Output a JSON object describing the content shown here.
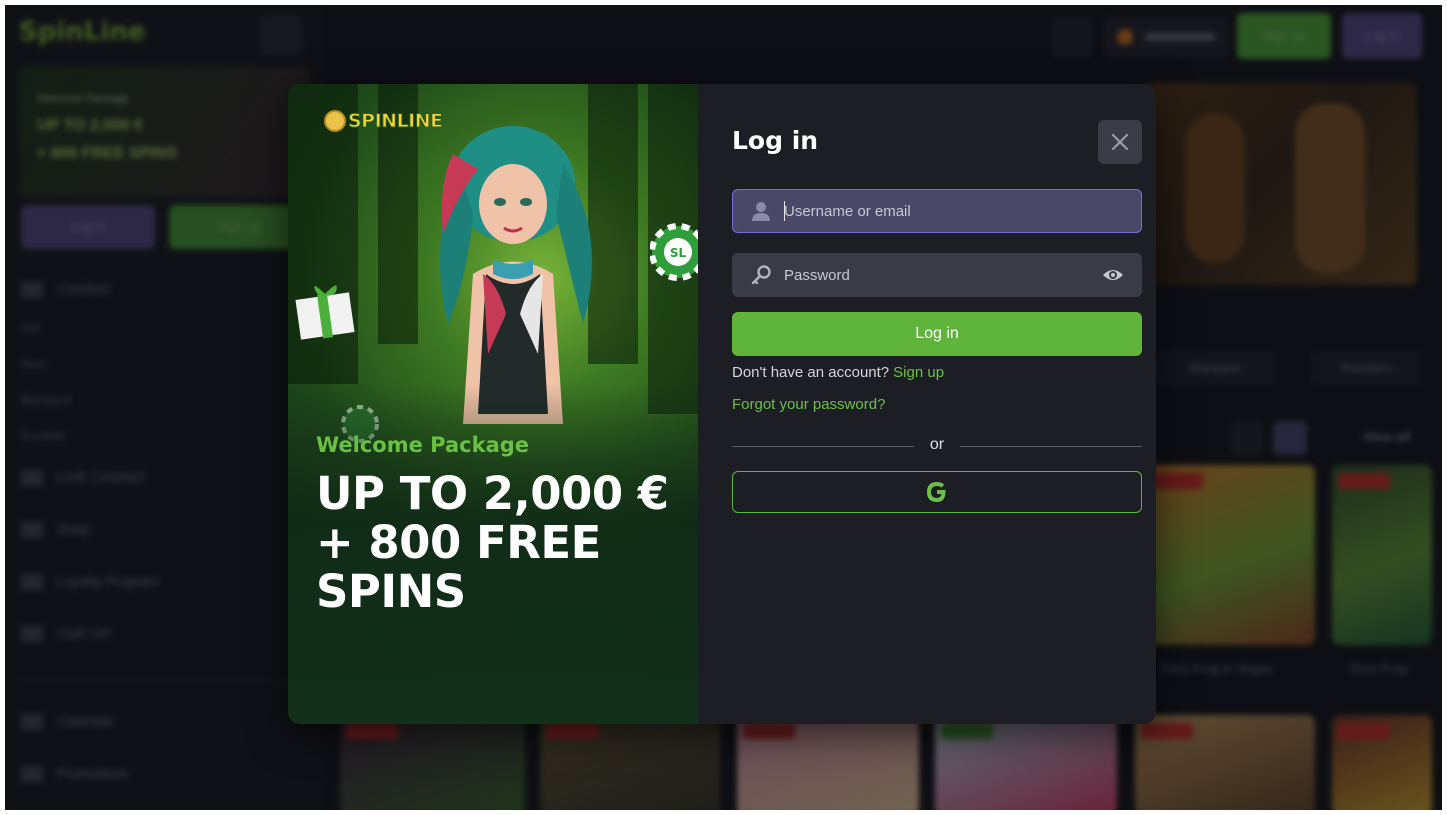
{
  "modal": {
    "title": "Log in",
    "promo": {
      "logo_text": "SPINLINE",
      "subtitle": "Welcome Package",
      "headline": "UP TO 2,000 € + 800 FREE SPINS"
    },
    "username_placeholder": "Username or email",
    "password_placeholder": "Password",
    "login_button_label": "Log in",
    "no_account_text": "Don't have an account?",
    "signup_link_label": "Sign up",
    "forgot_link_label": "Forgot your password?",
    "divider_label": "or",
    "google_icon": "google-g-icon",
    "close_icon": "close-icon"
  },
  "colors": {
    "accent_green": "#5fb43c",
    "active_field": "#4a4768",
    "panel_bg": "#1d1e24"
  }
}
